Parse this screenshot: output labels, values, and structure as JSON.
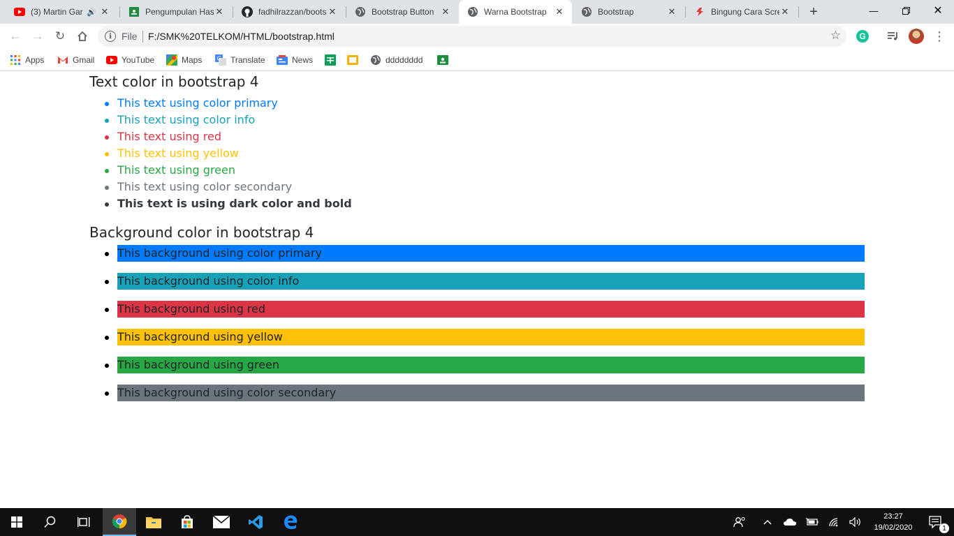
{
  "browser": {
    "tabs": [
      {
        "title": "(3) Martin Gar",
        "icon": "youtube-icon",
        "audio": true,
        "active": false
      },
      {
        "title": "Pengumpulan Has",
        "icon": "google-classroom-icon",
        "active": false
      },
      {
        "title": "fadhilrazzan/boots",
        "icon": "github-icon",
        "active": false
      },
      {
        "title": "Bootstrap Button",
        "icon": "globe-icon",
        "active": false
      },
      {
        "title": "Warna Bootstrap",
        "icon": "globe-icon",
        "active": true
      },
      {
        "title": "Bootstrap",
        "icon": "globe-icon",
        "active": false
      },
      {
        "title": "Bingung Cara Scre",
        "icon": "brand-icon",
        "active": false
      }
    ],
    "address": {
      "scheme": "File",
      "url": "F:/SMK%20TELKOM/HTML/bootstrap.html"
    },
    "bookmarks": [
      {
        "label": "Apps",
        "icon": "apps-grid-icon"
      },
      {
        "label": "Gmail",
        "icon": "gmail-icon"
      },
      {
        "label": "YouTube",
        "icon": "youtube-icon"
      },
      {
        "label": "Maps",
        "icon": "maps-icon"
      },
      {
        "label": "Translate",
        "icon": "translate-icon"
      },
      {
        "label": "News",
        "icon": "news-icon"
      },
      {
        "label": "",
        "icon": "sheets-icon"
      },
      {
        "label": "",
        "icon": "slides-icon"
      },
      {
        "label": "dddddddd",
        "icon": "globe-icon"
      },
      {
        "label": "",
        "icon": "classroom-icon"
      }
    ]
  },
  "page": {
    "text_heading": "Text color in bootstrap 4",
    "text_items": [
      {
        "label": "This text using color primary",
        "color": "#007bff"
      },
      {
        "label": "This text using color info",
        "color": "#17a2b8"
      },
      {
        "label": "This text using red",
        "color": "#dc3545"
      },
      {
        "label": "This text using yellow",
        "color": "#ffc107"
      },
      {
        "label": "This text using green",
        "color": "#28a745"
      },
      {
        "label": "This text using color secondary",
        "color": "#6c757d"
      },
      {
        "label": "This text is using dark color and bold",
        "color": "#343a40"
      }
    ],
    "bg_heading": "Background color in bootstrap 4",
    "bg_items": [
      {
        "label": "This background using color primary",
        "color": "#007bff"
      },
      {
        "label": "This background using color info",
        "color": "#17a2b8"
      },
      {
        "label": "This background using red",
        "color": "#dc3545"
      },
      {
        "label": "This background using yellow",
        "color": "#ffc107"
      },
      {
        "label": "This background using green",
        "color": "#28a745"
      },
      {
        "label": "This background using color secondary",
        "color": "#6c757d"
      }
    ]
  },
  "taskbar": {
    "time": "23:27",
    "date": "19/02/2020",
    "notification_count": "1"
  }
}
